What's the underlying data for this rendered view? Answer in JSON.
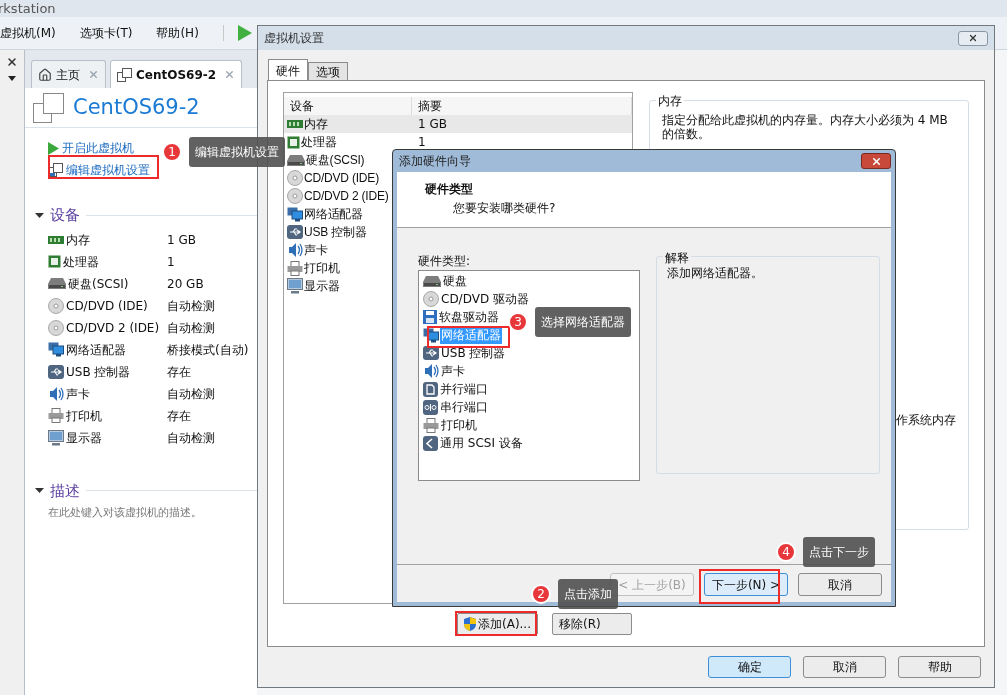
{
  "app": {
    "title": "rkstation",
    "menu": [
      "虚拟机(M)",
      "选项卡(T)",
      "帮助(H)"
    ],
    "tabs": [
      {
        "label": "主页",
        "selected": false,
        "kind": "home"
      },
      {
        "label": "CentOS69-2",
        "selected": true,
        "kind": "vm"
      }
    ],
    "vm_name": "CentOS69-2",
    "actions": [
      {
        "label": "开启此虚拟机",
        "kind": "power"
      },
      {
        "label": "编辑虚拟机设置",
        "kind": "edit"
      }
    ],
    "devices_heading": "设备",
    "devices": [
      {
        "name": "内存",
        "value": "1 GB",
        "kind": "memory"
      },
      {
        "name": "处理器",
        "value": "1",
        "kind": "cpu"
      },
      {
        "name": "硬盘(SCSI)",
        "value": "20 GB",
        "kind": "disk"
      },
      {
        "name": "CD/DVD (IDE)",
        "value": "自动检测",
        "kind": "cdrom"
      },
      {
        "name": "CD/DVD 2 (IDE)",
        "value": "自动检测",
        "kind": "cdrom"
      },
      {
        "name": "网络适配器",
        "value": "桥接模式(自动)",
        "kind": "network"
      },
      {
        "name": "USB 控制器",
        "value": "存在",
        "kind": "usb"
      },
      {
        "name": "声卡",
        "value": "自动检测",
        "kind": "sound"
      },
      {
        "name": "打印机",
        "value": "存在",
        "kind": "printer"
      },
      {
        "name": "显示器",
        "value": "自动检测",
        "kind": "display"
      }
    ],
    "description_heading": "描述",
    "description_placeholder": "在此处键入对该虚拟机的描述。"
  },
  "settings": {
    "title": "虚拟机设置",
    "tabs": [
      {
        "label": "硬件",
        "selected": true
      },
      {
        "label": "选项",
        "selected": false
      }
    ],
    "columns": [
      "设备",
      "摘要"
    ],
    "rows": [
      {
        "device": "内存",
        "summary": "1 GB",
        "kind": "memory",
        "selected": true
      },
      {
        "device": "处理器",
        "summary": "1",
        "kind": "cpu",
        "selected": false
      },
      {
        "device": "硬盘(SCSI)",
        "kind": "disk",
        "selected": false
      },
      {
        "device": "CD/DVD (IDE)",
        "kind": "cdrom",
        "selected": false
      },
      {
        "device": "CD/DVD 2 (IDE)",
        "kind": "cdrom",
        "selected": false
      },
      {
        "device": "网络适配器",
        "kind": "network",
        "selected": false
      },
      {
        "device": "USB 控制器",
        "kind": "usb",
        "selected": false
      },
      {
        "device": "声卡",
        "kind": "sound",
        "selected": false
      },
      {
        "device": "打印机",
        "kind": "printer",
        "selected": false
      },
      {
        "device": "显示器",
        "kind": "display",
        "selected": false
      }
    ],
    "memory_group": {
      "title": "内存",
      "text": "指定分配给此虚拟机的内存量。内存大小必须为 4 MB 的倍数。",
      "fragment": "作系统内存"
    },
    "list_buttons": [
      "添加(A)...",
      "移除(R)"
    ],
    "footer_buttons": [
      {
        "label": "确定",
        "default": true
      },
      {
        "label": "取消",
        "default": false
      },
      {
        "label": "帮助",
        "default": false
      }
    ]
  },
  "wizard": {
    "title": "添加硬件向导",
    "heading": "硬件类型",
    "subheading": "您要安装哪类硬件?",
    "list_label": "硬件类型:",
    "items": [
      {
        "label": "硬盘",
        "kind": "disk",
        "selected": false
      },
      {
        "label": "CD/DVD 驱动器",
        "kind": "cdrom",
        "selected": false
      },
      {
        "label": "软盘驱动器",
        "kind": "floppy",
        "selected": false
      },
      {
        "label": "网络适配器",
        "kind": "network",
        "selected": true
      },
      {
        "label": "USB 控制器",
        "kind": "usb",
        "selected": false
      },
      {
        "label": "声卡",
        "kind": "sound",
        "selected": false
      },
      {
        "label": "并行端口",
        "kind": "parallel",
        "selected": false
      },
      {
        "label": "串行端口",
        "kind": "serial",
        "selected": false
      },
      {
        "label": "打印机",
        "kind": "printer",
        "selected": false
      },
      {
        "label": "通用 SCSI 设备",
        "kind": "scsi",
        "selected": false
      }
    ],
    "explanation": {
      "title": "解释",
      "text": "添加网络适配器。"
    },
    "buttons": [
      {
        "label": "< 上一步(B)",
        "disabled": true,
        "default": false
      },
      {
        "label": "下一步(N) >",
        "disabled": false,
        "default": true
      },
      {
        "label": "取消",
        "disabled": false,
        "default": false
      }
    ]
  },
  "callouts": [
    {
      "number": "1",
      "text": "编辑虚拟机设置"
    },
    {
      "number": "3",
      "text": "选择网络适配器"
    },
    {
      "number": "4",
      "text": "点击下一步"
    },
    {
      "number": "2",
      "text": "点击添加"
    }
  ]
}
